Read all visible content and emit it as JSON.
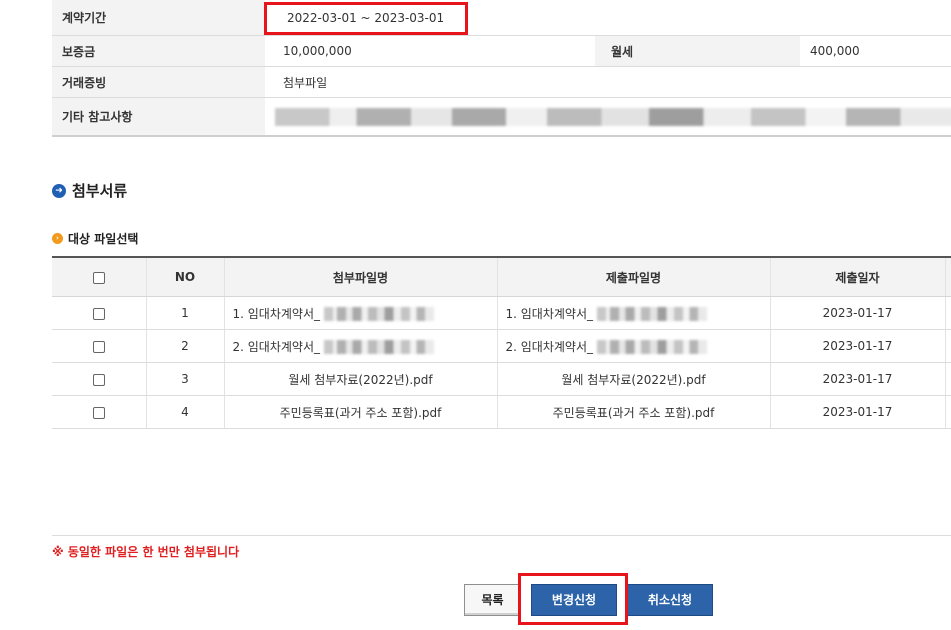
{
  "contract": {
    "period_label": "계약기간",
    "period_value": "2022-03-01 ~ 2023-03-01",
    "deposit_label": "보증금",
    "deposit_value": "10,000,000",
    "rent_label": "월세",
    "rent_value": "400,000",
    "proof_label": "거래증빙",
    "proof_value": "첨부파일",
    "etc_label": "기타 참고사항"
  },
  "attachments": {
    "section_title": "첨부서류",
    "sub_title": "대상 파일선택",
    "columns": [
      "NO",
      "첨부파일명",
      "제출파일명",
      "제출일자"
    ],
    "rows": [
      {
        "no": "1",
        "attach_name": "1. 임대차계약서_",
        "submit_name": "1. 임대차계약서_",
        "date": "2023-01-17"
      },
      {
        "no": "2",
        "attach_name": "2. 임대차계약서_",
        "submit_name": "2. 임대차계약서_",
        "date": "2023-01-17"
      },
      {
        "no": "3",
        "attach_name": "월세 첨부자료(2022년).pdf",
        "submit_name": "월세 첨부자료(2022년).pdf",
        "date": "2023-01-17"
      },
      {
        "no": "4",
        "attach_name": "주민등록표(과거 주소 포함).pdf",
        "submit_name": "주민등록표(과거 주소 포함).pdf",
        "date": "2023-01-17"
      }
    ]
  },
  "notice": "※ 동일한 파일은 한 번만 첨부됩니다",
  "buttons": {
    "list": "목록",
    "change": "변경신청",
    "cancel": "취소신청"
  },
  "colors": {
    "highlight": "#e8141b",
    "primary_button": "#2d63a8",
    "notice": "#e02020",
    "section_icon": "#1f5fb4",
    "sub_icon": "#f39a1e"
  }
}
